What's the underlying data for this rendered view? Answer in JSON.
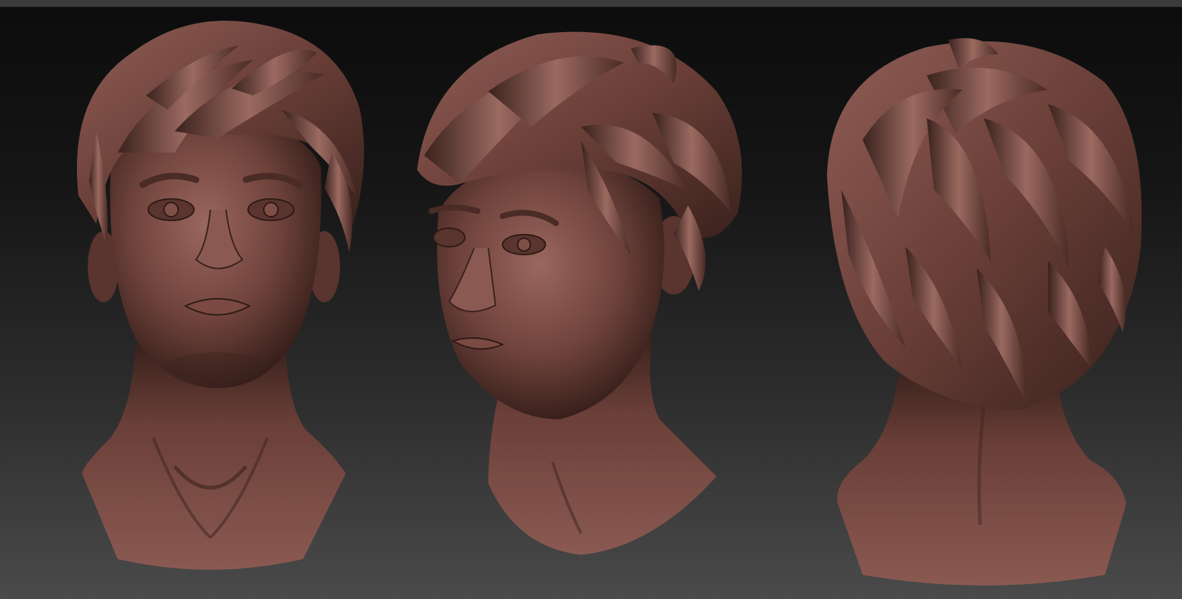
{
  "scene": {
    "background_top": "#0c0c0c",
    "background_bottom": "#4a4a4a",
    "material_base": "#6e423b",
    "material_highlight": "#a6736a",
    "material_shadow": "#2e1915"
  },
  "views": [
    {
      "label": "front-view"
    },
    {
      "label": "three-quarter-view"
    },
    {
      "label": "back-view"
    }
  ]
}
